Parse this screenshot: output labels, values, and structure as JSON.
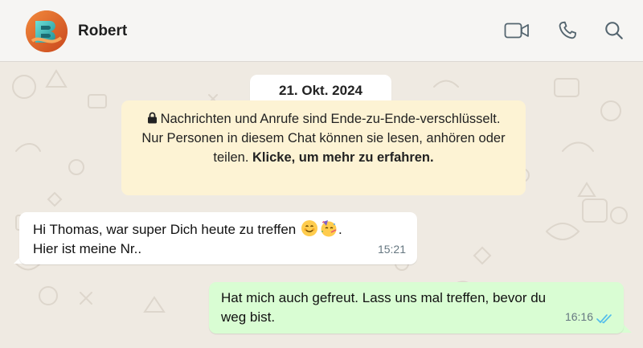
{
  "header": {
    "contact_name": "Robert",
    "icons": [
      "video-call-icon",
      "voice-call-icon",
      "search-icon"
    ]
  },
  "chat": {
    "date_label": "21. Okt. 2024",
    "encryption_notice": {
      "text": "Nachrichten und Anrufe sind Ende-zu-Ende-verschlüsselt. Nur Personen in diesem Chat können sie lesen, anhören oder teilen.",
      "link_text": "Klicke, um mehr zu erfahren."
    },
    "messages": [
      {
        "direction": "incoming",
        "line1": "Hi Thomas, war super Dich heute zu treffen",
        "emojis": [
          "smiling-face-emoji",
          "party-face-emoji"
        ],
        "line1_end": ".",
        "line2": "Hier ist meine Nr..",
        "time": "15:21"
      },
      {
        "direction": "outgoing",
        "line1": "Hat mich auch gefreut. Lass uns mal treffen, bevor du",
        "line2": "weg bist.",
        "time": "16:16",
        "status": "read"
      }
    ]
  },
  "colors": {
    "header_bg": "#f6f5f3",
    "chat_bg": "#efeae2",
    "notice_bg": "#fdf3d4",
    "outgoing_bg": "#d9fdd3",
    "read_tick": "#53bdeb"
  }
}
